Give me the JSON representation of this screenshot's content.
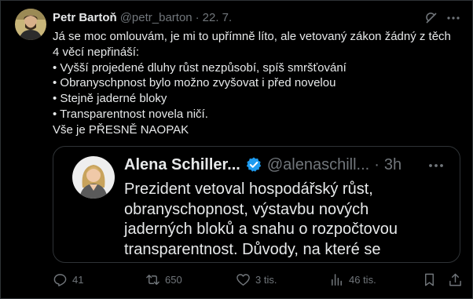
{
  "tweet": {
    "author_name": "Petr Bartoň",
    "handle": "@petr_barton",
    "separator": "·",
    "time": "22. 7.",
    "text_lines": [
      "Já se moc omlouvám, je mi to upřímně líto, ale vetovaný zákon žádný z těch",
      "4 věcí nepřináší:",
      "• Vyšší projedené dluhy růst nezpůsobí, spíš smršťování",
      "• Obranyschpnost bylo možno zvyšovat i před novelou",
      "• Stejně jaderné bloky",
      "• Transparentnost novela ničí.",
      "Vše je PŘESNĚ NAOPAK"
    ]
  },
  "quoted": {
    "author_name": "Alena Schiller...",
    "handle": "@alenaschill...",
    "separator": "·",
    "time": "3h",
    "text_lines": [
      "Prezident vetoval hospodářský růst,",
      "obranyschopnost, výstavbu nových",
      "jaderných bloků a snahu o rozpočtovou",
      "transparentnost. Důvody, na které se"
    ]
  },
  "actions": {
    "replies": "41",
    "reposts": "650",
    "likes": "3 tis.",
    "views": "46 tis."
  },
  "icons": {
    "grok": "grok-icon",
    "more": "more-icon",
    "verified": "verified-badge-icon",
    "reply": "reply-icon",
    "repost": "repost-icon",
    "like": "heart-icon",
    "views": "views-icon",
    "bookmark": "bookmark-icon",
    "share": "share-icon"
  },
  "colors": {
    "background": "#000000",
    "text": "#e7e9ea",
    "muted": "#71767b",
    "border": "#2f3336",
    "verified": "#1d9bf0"
  }
}
